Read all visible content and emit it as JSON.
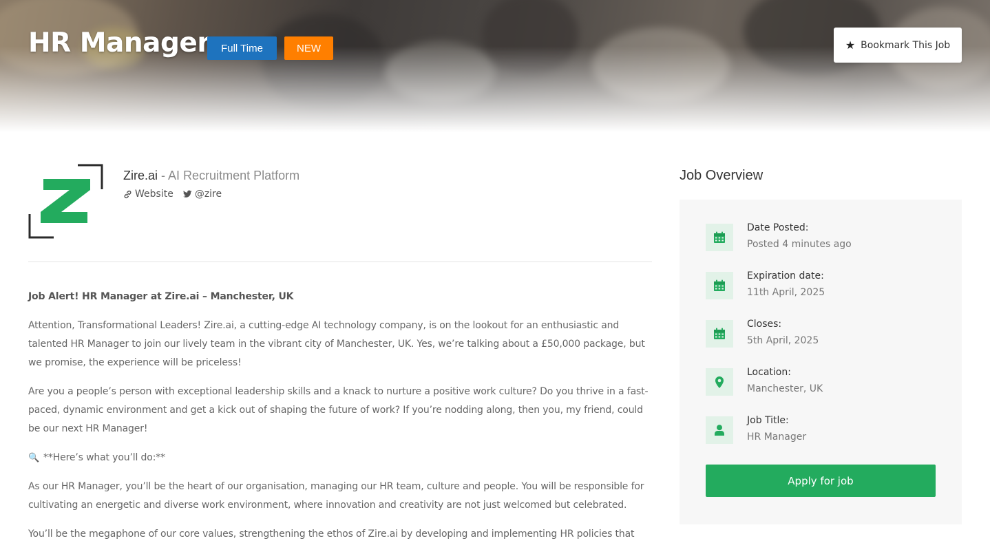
{
  "header": {
    "job_title": "HR Manager",
    "badge_type": "Full Time",
    "badge_new": "NEW",
    "bookmark_label": "Bookmark This Job"
  },
  "company": {
    "name": "Zire.ai",
    "separator": "-",
    "tagline": "AI Recruitment Platform",
    "website_label": "Website",
    "twitter_label": "@zire"
  },
  "description": {
    "heading": "Job Alert! HR Manager at Zire.ai – Manchester, UK",
    "p1": "Attention, Transformational Leaders! Zire.ai, a cutting-edge AI technology company, is on the lookout for an enthusiastic and talented HR Manager to join our lively team in the vibrant city of Manchester, UK. Yes, we’re talking about a £50,000 package, but we promise, the experience will be priceless!",
    "p2": "Are you a people’s person with exceptional leadership skills and a knack to nurture a positive work culture? Do you thrive in a fast-paced, dynamic environment and get a kick out of shaping the future of work? If you’re nodding along, then you, my friend, could be our next HR Manager!",
    "p3_icon": "🔍",
    "p3": "**Here’s what you’ll do:**",
    "p4": "As our HR Manager, you’ll be the heart of our organisation, managing our HR team, culture and people. You will be responsible for cultivating an energetic and diverse work environment, where innovation and creativity are not just welcomed but celebrated.",
    "p5": "You’ll be the megaphone of our core values, strengthening the ethos of Zire.ai by developing and implementing HR policies that"
  },
  "overview": {
    "title": "Job Overview",
    "items": [
      {
        "label": "Date Posted:",
        "value": "Posted 4 minutes ago",
        "icon": "calendar-icon"
      },
      {
        "label": "Expiration date:",
        "value": "11th April, 2025",
        "icon": "calendar-icon"
      },
      {
        "label": "Closes:",
        "value": "5th April, 2025",
        "icon": "calendar-icon"
      },
      {
        "label": "Location:",
        "value": "Manchester, UK",
        "icon": "map-marker-icon"
      },
      {
        "label": "Job Title:",
        "value": "HR Manager",
        "icon": "user-icon"
      }
    ],
    "apply_label": "Apply for job"
  },
  "colors": {
    "badge_full_time": "#1e73be",
    "badge_new": "#ff7f00",
    "accent_green": "#23ab5e",
    "icon_bg": "#e2f2e8"
  }
}
